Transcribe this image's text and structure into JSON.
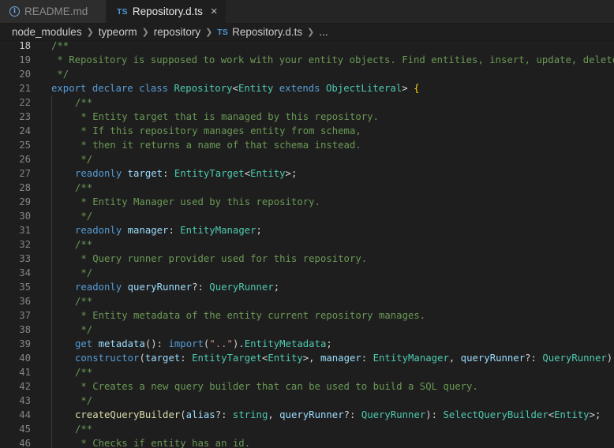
{
  "tabs": [
    {
      "label": "README.md",
      "icon": "info-icon",
      "active": false
    },
    {
      "label": "Repository.d.ts",
      "icon": "ts-icon",
      "badge": "TS",
      "active": true
    }
  ],
  "breadcrumb": {
    "items": [
      "node_modules",
      "typeorm",
      "repository",
      "Repository.d.ts",
      "..."
    ],
    "ts_badge": "TS"
  },
  "editor": {
    "current_line": 18,
    "lines": [
      {
        "n": 18,
        "ind": 0,
        "tokens": [
          [
            "/**",
            "c"
          ]
        ]
      },
      {
        "n": 19,
        "ind": 0,
        "tokens": [
          [
            " * Repository is supposed to work with your entity objects. Find entities, insert, update, delete, etc.",
            "c"
          ]
        ]
      },
      {
        "n": 20,
        "ind": 0,
        "tokens": [
          [
            " */",
            "c"
          ]
        ]
      },
      {
        "n": 21,
        "ind": 0,
        "tokens": [
          [
            "export ",
            "k"
          ],
          [
            "declare ",
            "k"
          ],
          [
            "class ",
            "k"
          ],
          [
            "Repository",
            "t"
          ],
          [
            "<",
            "o"
          ],
          [
            "Entity",
            "t"
          ],
          [
            " extends ",
            "k"
          ],
          [
            "ObjectLiteral",
            "t"
          ],
          [
            "> ",
            "o"
          ],
          [
            "{",
            "b"
          ]
        ]
      },
      {
        "n": 22,
        "ind": 1,
        "tokens": [
          [
            "/**",
            "c"
          ]
        ]
      },
      {
        "n": 23,
        "ind": 1,
        "tokens": [
          [
            " * Entity target that is managed by this repository.",
            "c"
          ]
        ]
      },
      {
        "n": 24,
        "ind": 1,
        "tokens": [
          [
            " * If this repository manages entity from schema,",
            "c"
          ]
        ]
      },
      {
        "n": 25,
        "ind": 1,
        "tokens": [
          [
            " * then it returns a name of that schema instead.",
            "c"
          ]
        ]
      },
      {
        "n": 26,
        "ind": 1,
        "tokens": [
          [
            " */",
            "c"
          ]
        ]
      },
      {
        "n": 27,
        "ind": 1,
        "tokens": [
          [
            "readonly ",
            "k"
          ],
          [
            "target",
            "p"
          ],
          [
            ": ",
            "o"
          ],
          [
            "EntityTarget",
            "t"
          ],
          [
            "<",
            "o"
          ],
          [
            "Entity",
            "t"
          ],
          [
            ">;",
            "o"
          ]
        ]
      },
      {
        "n": 28,
        "ind": 1,
        "tokens": [
          [
            "/**",
            "c"
          ]
        ]
      },
      {
        "n": 29,
        "ind": 1,
        "tokens": [
          [
            " * Entity Manager used by this repository.",
            "c"
          ]
        ]
      },
      {
        "n": 30,
        "ind": 1,
        "tokens": [
          [
            " */",
            "c"
          ]
        ]
      },
      {
        "n": 31,
        "ind": 1,
        "tokens": [
          [
            "readonly ",
            "k"
          ],
          [
            "manager",
            "p"
          ],
          [
            ": ",
            "o"
          ],
          [
            "EntityManager",
            "t"
          ],
          [
            ";",
            "o"
          ]
        ]
      },
      {
        "n": 32,
        "ind": 1,
        "tokens": [
          [
            "/**",
            "c"
          ]
        ]
      },
      {
        "n": 33,
        "ind": 1,
        "tokens": [
          [
            " * Query runner provider used for this repository.",
            "c"
          ]
        ]
      },
      {
        "n": 34,
        "ind": 1,
        "tokens": [
          [
            " */",
            "c"
          ]
        ]
      },
      {
        "n": 35,
        "ind": 1,
        "tokens": [
          [
            "readonly ",
            "k"
          ],
          [
            "queryRunner",
            "p"
          ],
          [
            "?: ",
            "o"
          ],
          [
            "QueryRunner",
            "t"
          ],
          [
            ";",
            "o"
          ]
        ]
      },
      {
        "n": 36,
        "ind": 1,
        "tokens": [
          [
            "/**",
            "c"
          ]
        ]
      },
      {
        "n": 37,
        "ind": 1,
        "tokens": [
          [
            " * Entity metadata of the entity current repository manages.",
            "c"
          ]
        ]
      },
      {
        "n": 38,
        "ind": 1,
        "tokens": [
          [
            " */",
            "c"
          ]
        ]
      },
      {
        "n": 39,
        "ind": 1,
        "tokens": [
          [
            "get ",
            "k"
          ],
          [
            "metadata",
            "p"
          ],
          [
            "(): ",
            "o"
          ],
          [
            "import",
            "k"
          ],
          [
            "(",
            "o"
          ],
          [
            "\"..\"",
            "s"
          ],
          [
            ").",
            "o"
          ],
          [
            "EntityMetadata",
            "t"
          ],
          [
            ";",
            "o"
          ]
        ]
      },
      {
        "n": 40,
        "ind": 1,
        "tokens": [
          [
            "constructor",
            "k"
          ],
          [
            "(",
            "o"
          ],
          [
            "target",
            "p"
          ],
          [
            ": ",
            "o"
          ],
          [
            "EntityTarget",
            "t"
          ],
          [
            "<",
            "o"
          ],
          [
            "Entity",
            "t"
          ],
          [
            ">, ",
            "o"
          ],
          [
            "manager",
            "p"
          ],
          [
            ": ",
            "o"
          ],
          [
            "EntityManager",
            "t"
          ],
          [
            ", ",
            "o"
          ],
          [
            "queryRunner",
            "p"
          ],
          [
            "?: ",
            "o"
          ],
          [
            "QueryRunner",
            "t"
          ],
          [
            ");",
            "o"
          ]
        ]
      },
      {
        "n": 41,
        "ind": 1,
        "tokens": [
          [
            "/**",
            "c"
          ]
        ]
      },
      {
        "n": 42,
        "ind": 1,
        "tokens": [
          [
            " * Creates a new query builder that can be used to build a SQL query.",
            "c"
          ]
        ]
      },
      {
        "n": 43,
        "ind": 1,
        "tokens": [
          [
            " */",
            "c"
          ]
        ]
      },
      {
        "n": 44,
        "ind": 1,
        "tokens": [
          [
            "createQueryBuilder",
            "f"
          ],
          [
            "(",
            "o"
          ],
          [
            "alias",
            "p"
          ],
          [
            "?: ",
            "o"
          ],
          [
            "string",
            "t"
          ],
          [
            ", ",
            "o"
          ],
          [
            "queryRunner",
            "p"
          ],
          [
            "?: ",
            "o"
          ],
          [
            "QueryRunner",
            "t"
          ],
          [
            "): ",
            "o"
          ],
          [
            "SelectQueryBuilder",
            "t"
          ],
          [
            "<",
            "o"
          ],
          [
            "Entity",
            "t"
          ],
          [
            ">;",
            "o"
          ]
        ]
      },
      {
        "n": 45,
        "ind": 1,
        "tokens": [
          [
            "/**",
            "c"
          ]
        ]
      },
      {
        "n": 46,
        "ind": 1,
        "tokens": [
          [
            " * Checks if entity has an id.",
            "c"
          ]
        ]
      }
    ]
  }
}
